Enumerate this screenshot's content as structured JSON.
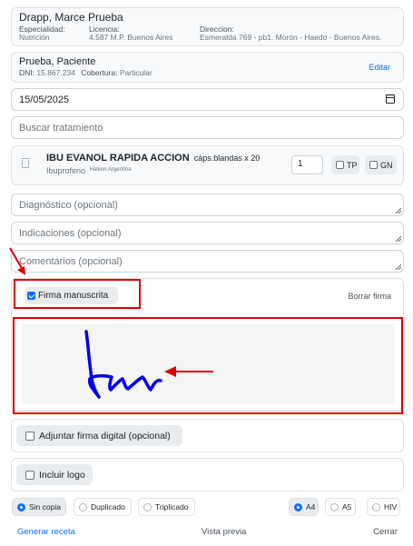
{
  "doctor": {
    "name": "Drapp, Marce Prueba",
    "specialty_label": "Especialidad:",
    "specialty": "Nutrición",
    "license_label": "Licencia:",
    "license": "4.587 M.P. Buenos Aires",
    "address_label": "Direccion:",
    "address": "Esmeralda 769 - pb1. Morón - Haedo - Buenos Aires."
  },
  "patient": {
    "name": "Prueba, Paciente",
    "dni_label": "DNI:",
    "dni": "15.867.234",
    "coverage_label": "Cobertura:",
    "coverage": "Particular",
    "edit_label": "Editar"
  },
  "date": {
    "value": "15/05/2025"
  },
  "search": {
    "placeholder": "Buscar tratamiento"
  },
  "drug": {
    "name": "IBU EVANOL RAPIDA ACCION",
    "presentation": "cáps.blandas x 20",
    "generic": "Ibuprofeno",
    "lab": "Haleon Argentina",
    "quantity": "1",
    "tp_label": "TP",
    "gn_label": "GN"
  },
  "fields": {
    "diagnosis_placeholder": "Diagnóstico (opcional)",
    "indications_placeholder": "Indicaciones (opcional)",
    "comments_placeholder": "Comentarios (opcional)"
  },
  "signature": {
    "handwritten_label": "Firma manuscrita",
    "handwritten_checked": true,
    "clear_label": "Borrar firma",
    "stroke_color": "#0000ee"
  },
  "options": {
    "digital_signature_label": "Adjuntar firma digital (opcional)",
    "logo_label": "Incluir logo"
  },
  "copies": [
    "Sin copia",
    "Duplicado",
    "Triplicado"
  ],
  "copies_selected": "Sin copia",
  "formats": [
    "A4",
    "A5",
    "HIV"
  ],
  "formats_selected": "A4",
  "footer": {
    "generate_label": "Generar receta",
    "preview_label": "Vista previa",
    "close_label": "Cerrar"
  },
  "colors": {
    "accent": "#0d6efd",
    "annotation_red": "#e00000"
  }
}
